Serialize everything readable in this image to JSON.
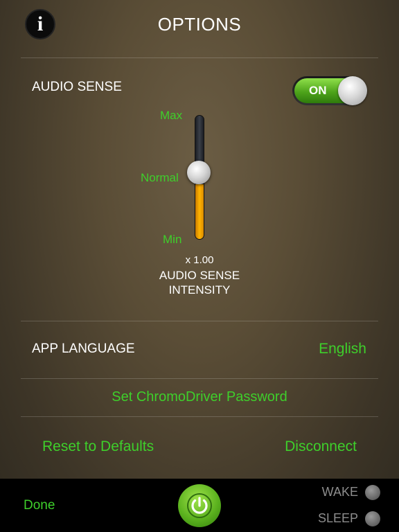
{
  "header": {
    "title": "OPTIONS",
    "info_icon": "info-icon",
    "info_glyph": "i"
  },
  "audio_sense": {
    "label": "AUDIO SENSE",
    "toggle_text": "ON",
    "toggle_state": true,
    "toggle_color": "#4ea41b"
  },
  "intensity": {
    "max_label": "Max",
    "normal_label": "Normal",
    "min_label": "Min",
    "multiplier": "x 1.00",
    "caption_line1": "AUDIO SENSE",
    "caption_line2": "INTENSITY",
    "level": 0.5,
    "fill_color": "#ffb400"
  },
  "language": {
    "label": "APP LANGUAGE",
    "value": "English"
  },
  "password_link": "Set ChromoDriver Password",
  "actions": {
    "reset": "Reset to Defaults",
    "disconnect": "Disconnect"
  },
  "bottom_bar": {
    "done": "Done",
    "power_icon": "power-icon",
    "wake": "WAKE",
    "sleep": "SLEEP"
  },
  "colors": {
    "accent_green": "#3ecf2b",
    "power_green": "#5cb21f"
  }
}
